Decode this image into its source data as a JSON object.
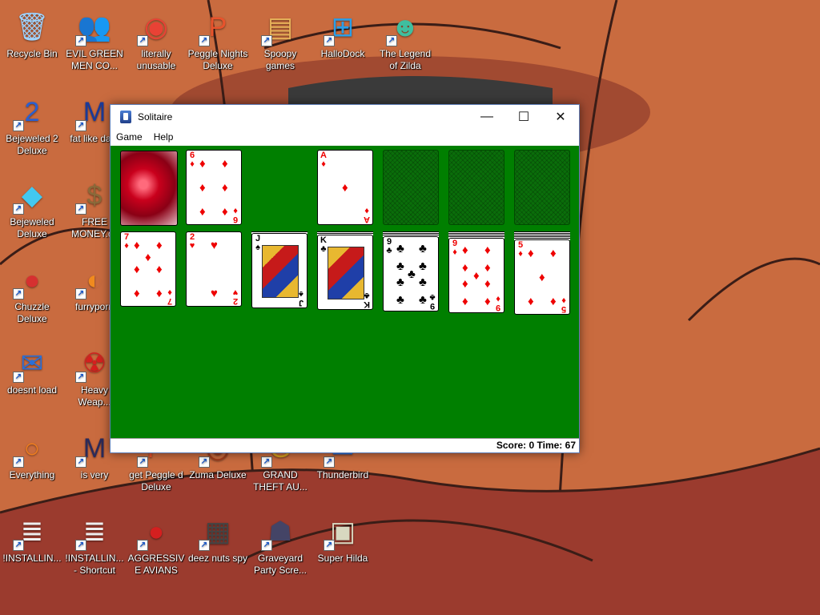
{
  "desktop_icons": [
    {
      "id": "recycle-bin",
      "label": "Recycle Bin",
      "icon": "recycle-bin-icon"
    },
    {
      "id": "evil-green-men",
      "label": "EVIL GREEN MEN CO...",
      "icon": "people-icon"
    },
    {
      "id": "literally-unusable",
      "label": "literally unusable",
      "icon": "chrome-icon"
    },
    {
      "id": "peggle-nights",
      "label": "Peggle Nights Deluxe",
      "icon": "peggle-icon"
    },
    {
      "id": "spoopy-games",
      "label": "Spoopy games",
      "icon": "folder-icon"
    },
    {
      "id": "hallodock",
      "label": "HalloDock",
      "icon": "windows-logo-icon"
    },
    {
      "id": "legend-of-zilda",
      "label": "The Legend of Zilda",
      "icon": "character-icon"
    },
    {
      "id": "bejeweled2",
      "label": "Bejeweled 2 Deluxe",
      "icon": "gem-2-icon"
    },
    {
      "id": "fat-like-dark",
      "label": "fat like dark",
      "icon": "mp-logo-icon"
    },
    {
      "id": "bejeweled",
      "label": "Bejeweled Deluxe",
      "icon": "diamond-icon"
    },
    {
      "id": "free-money",
      "label": "FREE MONEY.cc",
      "icon": "money-bag-icon"
    },
    {
      "id": "chuzzle",
      "label": "Chuzzle Deluxe",
      "icon": "chuzzle-icon"
    },
    {
      "id": "furryporn",
      "label": "furryporn",
      "icon": "firefox-icon"
    },
    {
      "id": "doesnt-load",
      "label": "doesnt load",
      "icon": "thunderbird-icon"
    },
    {
      "id": "heavy-weapon",
      "label": "Heavy Weap...",
      "icon": "radiation-icon"
    },
    {
      "id": "everything",
      "label": "Everything",
      "icon": "magnifier-icon"
    },
    {
      "id": "is-very",
      "label": "is very",
      "icon": "mp-shield-icon"
    },
    {
      "id": "get-peggled",
      "label": "get Peggle d Deluxe",
      "icon": "peggle-icon"
    },
    {
      "id": "zuma",
      "label": "Zuma Deluxe",
      "icon": "zuma-icon"
    },
    {
      "id": "gta",
      "label": "GRAND THEFT AU...",
      "icon": "gta-icon"
    },
    {
      "id": "thunderbird",
      "label": "Thunderbird",
      "icon": "thunderbird-icon"
    },
    {
      "id": "installing1",
      "label": "!INSTALLIN...",
      "icon": "text-file-icon"
    },
    {
      "id": "installing2",
      "label": "!INSTALLIN... - Shortcut",
      "icon": "text-file-icon"
    },
    {
      "id": "aggressive-avians",
      "label": "AGGRESSIVE AVIANS",
      "icon": "angry-bird-icon"
    },
    {
      "id": "deez-nuts-spy",
      "label": "deez nuts spy",
      "icon": "stack-icon"
    },
    {
      "id": "graveyard",
      "label": "Graveyard Party Scre...",
      "icon": "tombstone-icon"
    },
    {
      "id": "super-hilda",
      "label": "Super Hilda",
      "icon": "pixel-character-icon"
    }
  ],
  "window": {
    "title": "Solitaire",
    "menu": [
      "Game",
      "Help"
    ],
    "minimize": "—",
    "maximize": "☐",
    "close": "✕"
  },
  "game": {
    "waste_top": {
      "rank": "6",
      "suit": "♦",
      "color": "red"
    },
    "foundation_1": {
      "rank": "A",
      "suit": "♦",
      "color": "red"
    },
    "tableau": [
      {
        "rank": "7",
        "suit": "♦",
        "color": "red"
      },
      {
        "rank": "2",
        "suit": "♥",
        "color": "red"
      },
      {
        "rank": "J",
        "suit": "♠",
        "color": "black"
      },
      {
        "rank": "K",
        "suit": "♣",
        "color": "black"
      },
      {
        "rank": "9",
        "suit": "♣",
        "color": "black"
      },
      {
        "rank": "9",
        "suit": "♦",
        "color": "red"
      },
      {
        "rank": "5",
        "suit": "♦",
        "color": "red"
      }
    ]
  },
  "status": {
    "text": "Score: 0 Time: 67"
  },
  "colors": {
    "felt": "#007f00",
    "wallpaper": "#c8693e",
    "red_suit": "#e00000"
  }
}
